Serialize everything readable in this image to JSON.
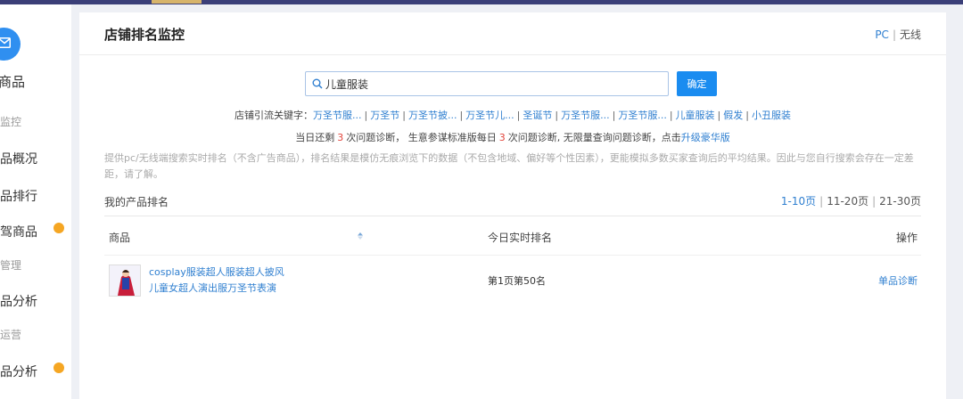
{
  "sidebar": {
    "top_label": "商品",
    "items": [
      {
        "label": "监控",
        "kind": "sub",
        "dot": false
      },
      {
        "label": "品概况",
        "kind": "main",
        "dot": false
      },
      {
        "label": "品排行",
        "kind": "main",
        "dot": false
      },
      {
        "label": "驾商品",
        "kind": "main",
        "dot": true
      },
      {
        "label": "管理",
        "kind": "sub",
        "dot": false
      },
      {
        "label": "品分析",
        "kind": "main",
        "dot": false
      },
      {
        "label": "运营",
        "kind": "sub",
        "dot": false
      },
      {
        "label": "品分析",
        "kind": "main",
        "dot": true
      }
    ],
    "dot_color": "#f5a623"
  },
  "header": {
    "title": "店铺排名监控",
    "platform_pc": "PC",
    "platform_sep": "|",
    "platform_wireless": "无线"
  },
  "search": {
    "value": "儿童服装",
    "confirm_label": "确定"
  },
  "keywords": {
    "label": "店铺引流关键字：",
    "items": [
      "万圣节服...",
      "万圣节",
      "万圣节披...",
      "万圣节儿...",
      "圣诞节",
      "万圣节服...",
      "万圣节服...",
      "儿童服装",
      "假发",
      "小丑服装"
    ]
  },
  "remain": {
    "prefix": "当日还剩",
    "count1": "3",
    "mid": "次问题诊断， 生意参谋标准版每日",
    "count2": "3",
    "suffix": "次问题诊断, 无限量查询问题诊断，点击",
    "link": "升级豪华版"
  },
  "note": "提供pc/无线端搜索实时排名（不含广告商品），排名结果是模仿无痕浏览下的数据（不包含地域、偏好等个性因素），更能模拟多数买家查询后的平均结果。因此与您自行搜索会存在一定差距，请了解。",
  "ranking": {
    "section_title": "我的产品排名",
    "pages": [
      "1-10页",
      "11-20页",
      "21-30页"
    ],
    "page_sep": "|",
    "columns": {
      "product": "商品",
      "realtime_rank": "今日实时排名",
      "action": "操作"
    },
    "rows": [
      {
        "title_line1": "cosplay服装超人服装超人披风",
        "title_line2": "儿童女超人演出服万圣节表演",
        "rank": "第1页第50名",
        "action": "单品诊断"
      }
    ]
  },
  "colors": {
    "accent": "#2f7fd0",
    "button": "#1a8cf0",
    "highlight_red": "#e2453c",
    "topbar": "#3b3f78"
  }
}
